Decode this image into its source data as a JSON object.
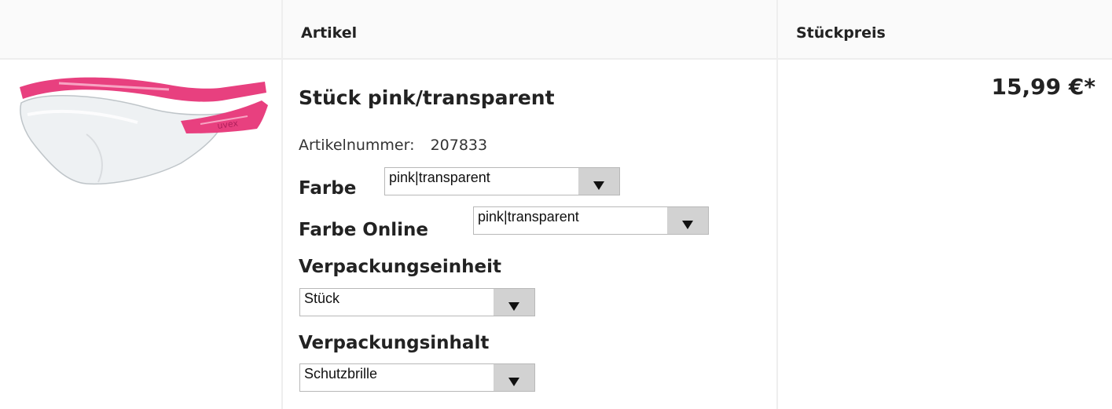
{
  "table": {
    "headers": {
      "image": "",
      "article": "Artikel",
      "unit_price": "Stückpreis"
    }
  },
  "product": {
    "title": "Stück pink/transparent",
    "sku_label": "Artikelnummer:",
    "sku_value": "207833",
    "image_icon": "safety-glasses-pink",
    "price": "15,99 €*"
  },
  "options": {
    "farbe": {
      "label": "Farbe",
      "selected": "pink|transparent"
    },
    "farbe_online": {
      "label": "Farbe Online",
      "selected": "pink|transparent"
    },
    "verpackungseinheit": {
      "label": "Verpackungseinheit",
      "selected": "Stück"
    },
    "verpackungsinhalt": {
      "label": "Verpackungsinhalt",
      "selected": "Schutzbrille"
    }
  },
  "colors": {
    "frame_accent": "#e8407f",
    "border": "#eeeeee",
    "select_button": "#d2d2d2"
  }
}
